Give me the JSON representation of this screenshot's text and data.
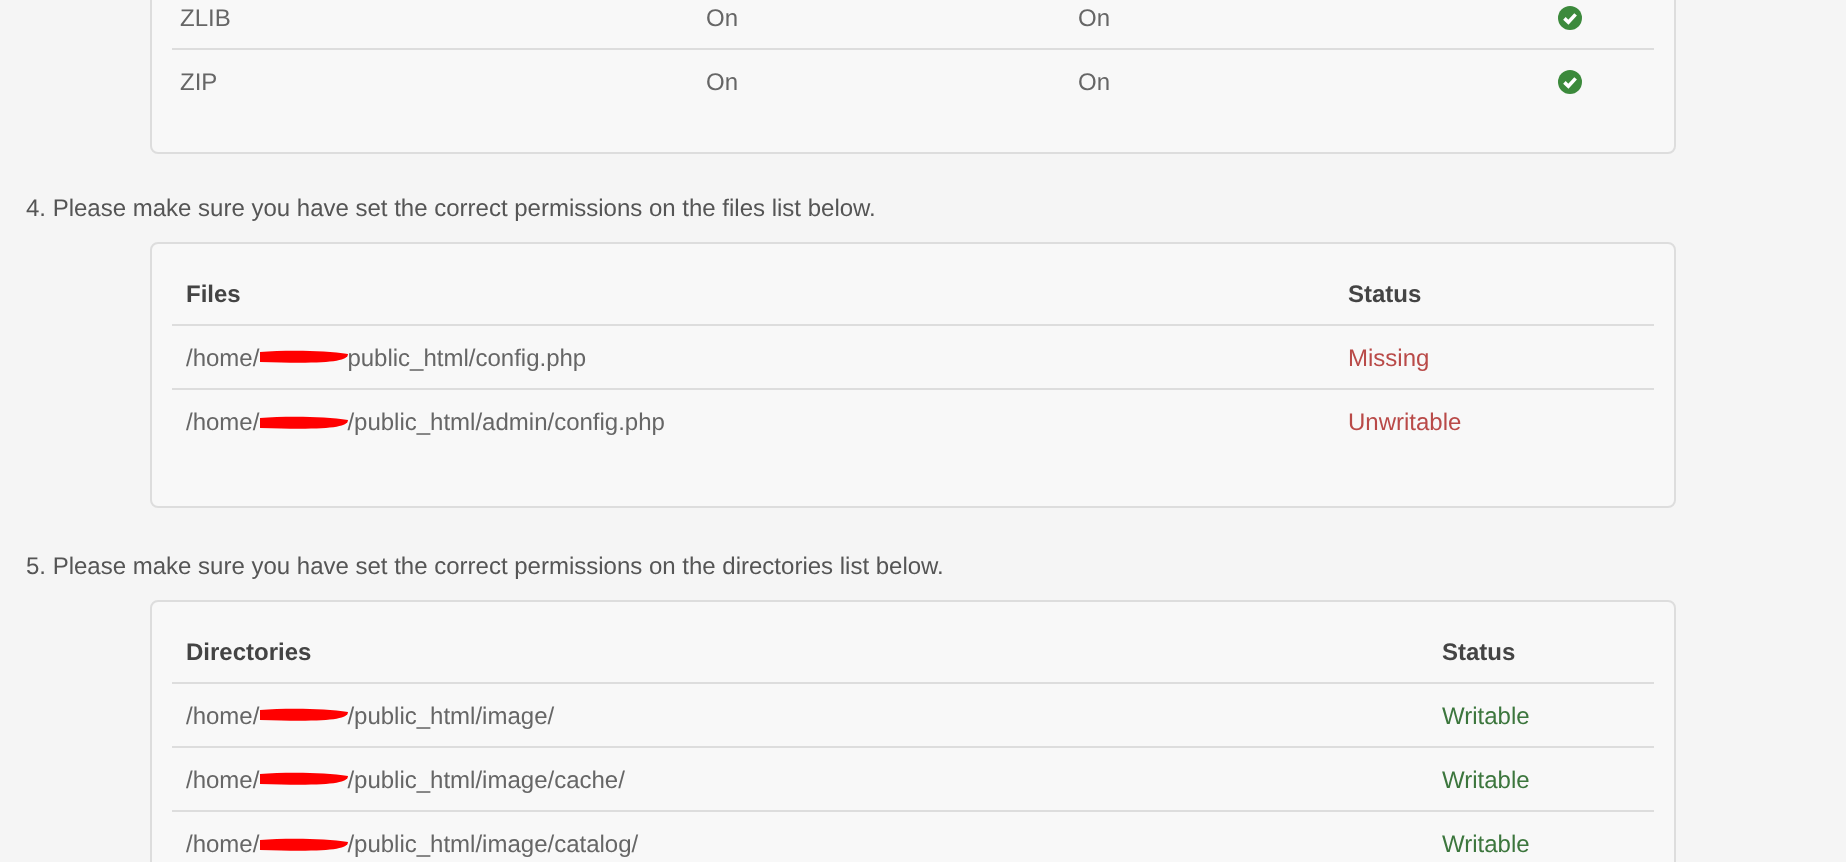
{
  "extensions": {
    "rows": [
      {
        "name": "ZLIB",
        "current": "On",
        "required": "On",
        "ok": true
      },
      {
        "name": "ZIP",
        "current": "On",
        "required": "On",
        "ok": true
      }
    ]
  },
  "files": {
    "instruction": "4. Please make sure you have set the correct permissions on the files list below.",
    "columns": [
      "Files",
      "Status"
    ],
    "rows": [
      {
        "prefix": "/home/",
        "suffix": "public_html/config.php",
        "status": "Missing",
        "ok": false
      },
      {
        "prefix": "/home/",
        "suffix": "/public_html/admin/config.php",
        "status": "Unwritable",
        "ok": false
      }
    ]
  },
  "directories": {
    "instruction": "5. Please make sure you have set the correct permissions on the directories list below.",
    "columns": [
      "Directories",
      "Status"
    ],
    "rows": [
      {
        "prefix": "/home/",
        "suffix": "/public_html/image/",
        "status": "Writable",
        "ok": true
      },
      {
        "prefix": "/home/",
        "suffix": "/public_html/image/cache/",
        "status": "Writable",
        "ok": true
      },
      {
        "prefix": "/home/",
        "suffix": "/public_html/image/catalog/",
        "status": "Writable",
        "ok": true
      }
    ]
  }
}
